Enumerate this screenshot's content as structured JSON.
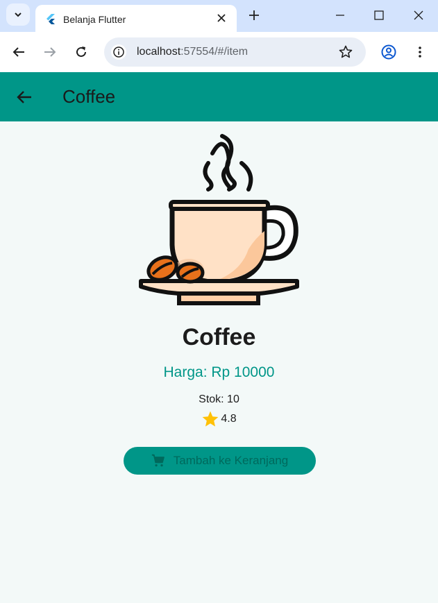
{
  "browser": {
    "tab_title": "Belanja Flutter",
    "url_host": "localhost",
    "url_path": ":57554/#/item"
  },
  "appbar": {
    "title": "Coffee"
  },
  "product": {
    "name": "Coffee",
    "price_text": "Harga: Rp 10000",
    "stock_text": "Stok: 10",
    "rating": "4.8",
    "cart_button_label": "Tambah ke Keranjang"
  },
  "colors": {
    "primary": "#009688",
    "background": "#f3f9f8",
    "star": "#ffc107",
    "tabstrip": "#d3e3fd"
  },
  "icons": [
    "tab-list-icon",
    "flutter-logo-icon",
    "close-icon",
    "plus-icon",
    "minimize-icon",
    "maximize-icon",
    "window-close-icon",
    "back-icon",
    "forward-icon",
    "reload-icon",
    "info-icon",
    "bookmark-star-icon",
    "profile-icon",
    "menu-icon",
    "arrow-back-icon",
    "coffee-cup-icon",
    "star-icon",
    "cart-icon"
  ]
}
